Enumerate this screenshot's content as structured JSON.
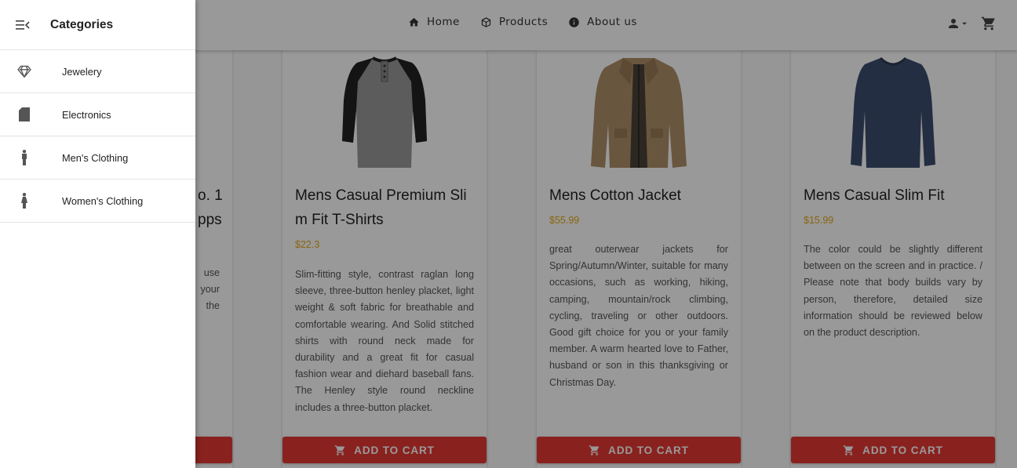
{
  "nav": {
    "home": "Home",
    "products": "Products",
    "about": "About us"
  },
  "drawer": {
    "title": "Categories",
    "items": [
      {
        "label": "Jewelery",
        "icon": "gem-icon"
      },
      {
        "label": "Electronics",
        "icon": "sd-card-icon"
      },
      {
        "label": "Men's Clothing",
        "icon": "male-icon"
      },
      {
        "label": "Women's Clothing",
        "icon": "female-icon"
      }
    ]
  },
  "partial_card": {
    "title_fragments": [
      "o. 1",
      "pps"
    ],
    "desc_fragments": [
      "use",
      "your",
      "the"
    ]
  },
  "products": [
    {
      "title": "Mens Casual Premium Slim Fit T-Shirts",
      "price": "$22.3",
      "description": "Slim-fitting style, contrast raglan long sleeve, three-button henley placket, light weight & soft fabric for breathable and comfortable wearing. And Solid stitched shirts with round neck made for durability and a great fit for casual fashion wear and diehard baseball fans. The Henley style round neckline includes a three-button placket.",
      "button": "ADD TO CART"
    },
    {
      "title": "Mens Cotton Jacket",
      "price": "$55.99",
      "description": "great outerwear jackets for Spring/Autumn/Winter, suitable for many occasions, such as working, hiking, camping, mountain/rock climbing, cycling, traveling or other outdoors. Good gift choice for you or your family member. A warm hearted love to Father, husband or son in this thanksgiving or Christmas Day.",
      "button": "ADD TO CART"
    },
    {
      "title": "Mens Casual Slim Fit",
      "price": "$15.99",
      "description": "The color could be slightly different between on the screen and in practice. / Please note that body builds vary by person, therefore, detailed size information should be reviewed below on the product description.",
      "button": "ADD TO CART"
    }
  ],
  "colors": {
    "accent": "#e53935",
    "price": "#e6a817",
    "overlay": "rgba(0,0,0,0.4)"
  }
}
